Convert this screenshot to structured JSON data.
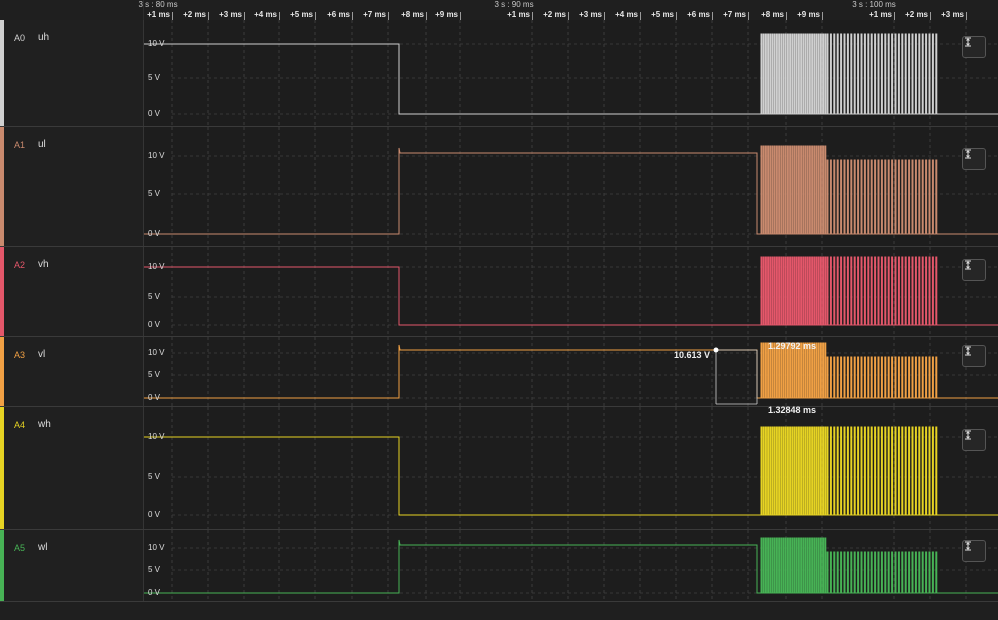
{
  "timeline": {
    "major": [
      "3 s : 80 ms",
      "3 s : 90 ms",
      "3 s : 100 ms"
    ],
    "ticks": [
      "+1 ms",
      "+2 ms",
      "+3 ms",
      "+4 ms",
      "+5 ms",
      "+6 ms",
      "+7 ms",
      "+8 ms",
      "+9 ms",
      "+1 ms",
      "+2 ms",
      "+3 ms",
      "+4 ms",
      "+5 ms",
      "+6 ms",
      "+7 ms",
      "+8 ms",
      "+9 ms",
      "+1 ms",
      "+2 ms",
      "+3 ms"
    ]
  },
  "channels": [
    {
      "id": "A0",
      "name": "uh",
      "color": "#d0d0d0",
      "labels": [
        "10 V",
        "5 V",
        "0 V"
      ]
    },
    {
      "id": "A1",
      "name": "ul",
      "color": "#c98a6e",
      "labels": [
        "10 V",
        "5 V",
        "0 V"
      ]
    },
    {
      "id": "A2",
      "name": "vh",
      "color": "#e4576a",
      "labels": [
        "10 V",
        "5 V",
        "0 V"
      ]
    },
    {
      "id": "A3",
      "name": "vl",
      "color": "#f0a044",
      "labels": [
        "10 V",
        "5 V",
        "0 V"
      ]
    },
    {
      "id": "A4",
      "name": "wh",
      "color": "#e6d323",
      "labels": [
        "10 V",
        "5 V",
        "0 V"
      ]
    },
    {
      "id": "A5",
      "name": "wl",
      "color": "#47b255",
      "labels": [
        "10 V",
        "5 V",
        "0 V"
      ]
    }
  ],
  "measurement": {
    "voltage": "10.613 V",
    "pulse_width": "1.29792 ms",
    "period": "1.32848 ms"
  },
  "icons": {
    "scale": "vertical-scale-icon"
  }
}
